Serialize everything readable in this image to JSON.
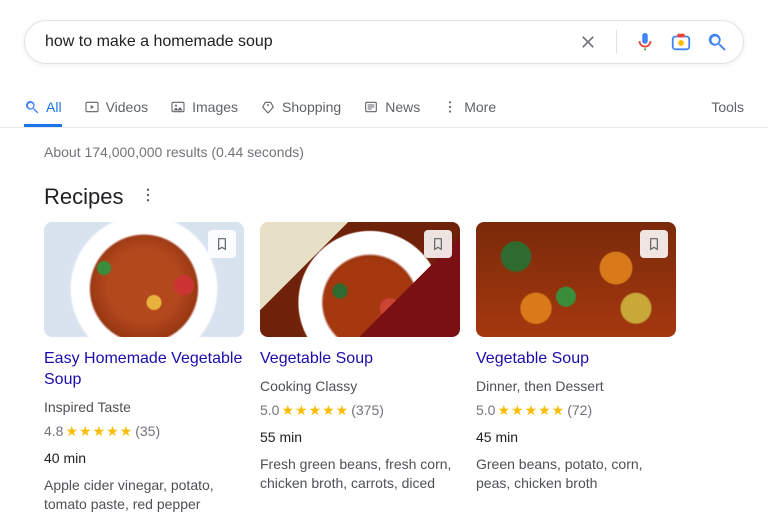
{
  "search": {
    "query": "how to make a homemade soup"
  },
  "tabs": {
    "all": "All",
    "videos": "Videos",
    "images": "Images",
    "shopping": "Shopping",
    "news": "News",
    "more": "More",
    "tools": "Tools"
  },
  "stats": "About 174,000,000 results (0.44 seconds)",
  "section": {
    "title": "Recipes"
  },
  "recipes": [
    {
      "title": "Easy Homemade Vegetable Soup",
      "source": "Inspired Taste",
      "rating": "4.8",
      "count": "(35)",
      "time": "40 min",
      "desc": "Apple cider vinegar, potato, tomato paste, red pepper"
    },
    {
      "title": "Vegetable Soup",
      "source": "Cooking Classy",
      "rating": "5.0",
      "count": "(375)",
      "time": "55 min",
      "desc": "Fresh green beans, fresh corn, chicken broth, carrots, diced"
    },
    {
      "title": "Vegetable Soup",
      "source": "Dinner, then Dessert",
      "rating": "5.0",
      "count": "(72)",
      "time": "45 min",
      "desc": "Green beans, potato, corn, peas, chicken broth"
    }
  ]
}
